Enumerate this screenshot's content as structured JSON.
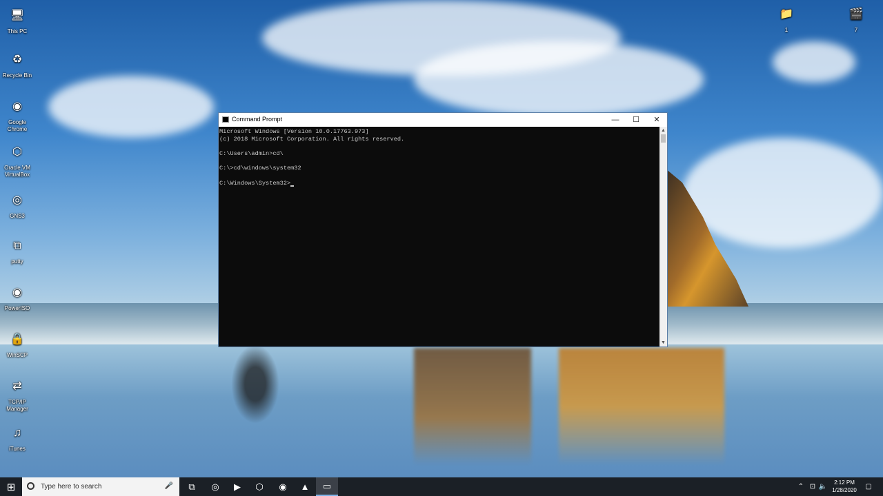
{
  "desktop": {
    "icons_left": [
      {
        "name": "this-pc",
        "label": "This PC",
        "glyph": "🖥",
        "bg": "transparent"
      },
      {
        "name": "recycle-bin",
        "label": "Recycle Bin",
        "glyph": "♻",
        "bg": "transparent"
      },
      {
        "name": "google-chrome",
        "label": "Google Chrome",
        "glyph": "◉",
        "bg": "transparent"
      },
      {
        "name": "oracle-vm-virtualbox",
        "label": "Oracle VM VirtualBox",
        "glyph": "⬡",
        "bg": "transparent"
      },
      {
        "name": "gns3",
        "label": "GNS3",
        "glyph": "◎",
        "bg": "transparent"
      },
      {
        "name": "putty",
        "label": "putty",
        "glyph": "⧉",
        "bg": "transparent"
      },
      {
        "name": "poweriso",
        "label": "PowerISO",
        "glyph": "◉",
        "bg": "transparent"
      },
      {
        "name": "winscp",
        "label": "WinSCP",
        "glyph": "🔒",
        "bg": "transparent"
      },
      {
        "name": "tcpip-manager",
        "label": "TCP/IP Manager",
        "glyph": "⇄",
        "bg": "transparent"
      },
      {
        "name": "itunes",
        "label": "iTunes",
        "glyph": "♫",
        "bg": "transparent"
      }
    ],
    "icons_right": [
      {
        "name": "folder-1",
        "label": "1",
        "glyph": "📁"
      },
      {
        "name": "video-7",
        "label": "7",
        "glyph": "🎬"
      }
    ]
  },
  "cmd_window": {
    "title": "Command Prompt",
    "minimize": "—",
    "maximize": "☐",
    "close": "✕",
    "lines": [
      "Microsoft Windows [Version 10.0.17763.973]",
      "(c) 2018 Microsoft Corporation. All rights reserved.",
      "",
      "C:\\Users\\admin>cd\\",
      "",
      "C:\\>cd\\windows\\system32",
      "",
      "C:\\Windows\\System32>"
    ],
    "scroll_up": "▲",
    "scroll_down": "▼"
  },
  "taskbar": {
    "start_glyph": "⊞",
    "search_placeholder": "Type here to search",
    "mic_glyph": "🎤",
    "apps": [
      {
        "name": "task-view",
        "glyph": "⧉"
      },
      {
        "name": "app-gns3",
        "glyph": "◎"
      },
      {
        "name": "app-powershell",
        "glyph": "▶"
      },
      {
        "name": "app-virtualbox",
        "glyph": "⬡"
      },
      {
        "name": "app-chrome",
        "glyph": "◉"
      },
      {
        "name": "app-vlc",
        "glyph": "▲"
      },
      {
        "name": "app-command-prompt",
        "glyph": "▭"
      }
    ],
    "tray": {
      "chevron": "⌃",
      "network": "⊡",
      "volume": "🔈",
      "time": "2:12 PM",
      "date": "1/28/2020",
      "notifications": "▢"
    }
  }
}
